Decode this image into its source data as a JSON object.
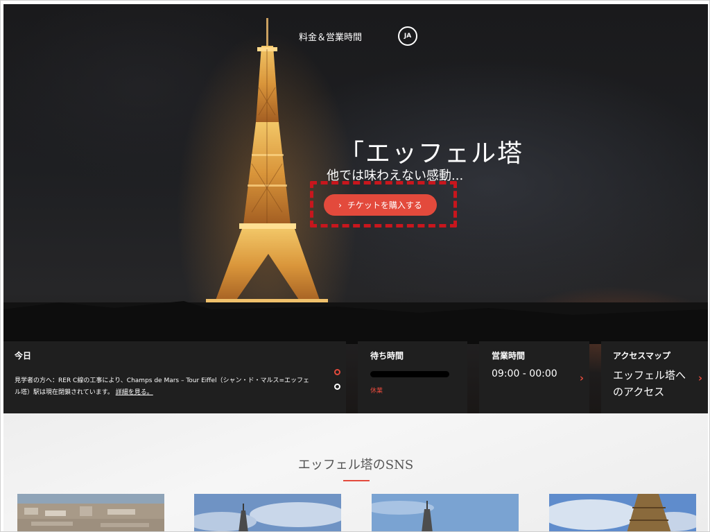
{
  "nav": {
    "rates_link": "料金＆営業時間",
    "lang": "JA"
  },
  "hero": {
    "title": "「エッフェル塔",
    "subtitle": "他では味わえない感動...",
    "cta_label": "チケットを購入する",
    "cta_icon": "chevron-right-icon"
  },
  "cards": {
    "today": {
      "title": "今日",
      "notice": "見学者の方へ：RER C線の工事により、Champs de Mars – Tour Eiffel（シャン・ド・マルス=エッフェル塔）駅は現在閉鎖されています。",
      "link": "詳細を見る。"
    },
    "wait": {
      "title": "待ち時間",
      "status": "休業"
    },
    "hours": {
      "title": "営業時間",
      "value": "09:00 - 00:00"
    },
    "access": {
      "title": "アクセスマップ",
      "text": "エッフェル塔へのアクセス"
    }
  },
  "sns": {
    "title": "エッフェル塔のSNS"
  },
  "colors": {
    "accent": "#e34a3c",
    "highlight": "#c8161d",
    "card_bg": "#1f1f1f"
  }
}
